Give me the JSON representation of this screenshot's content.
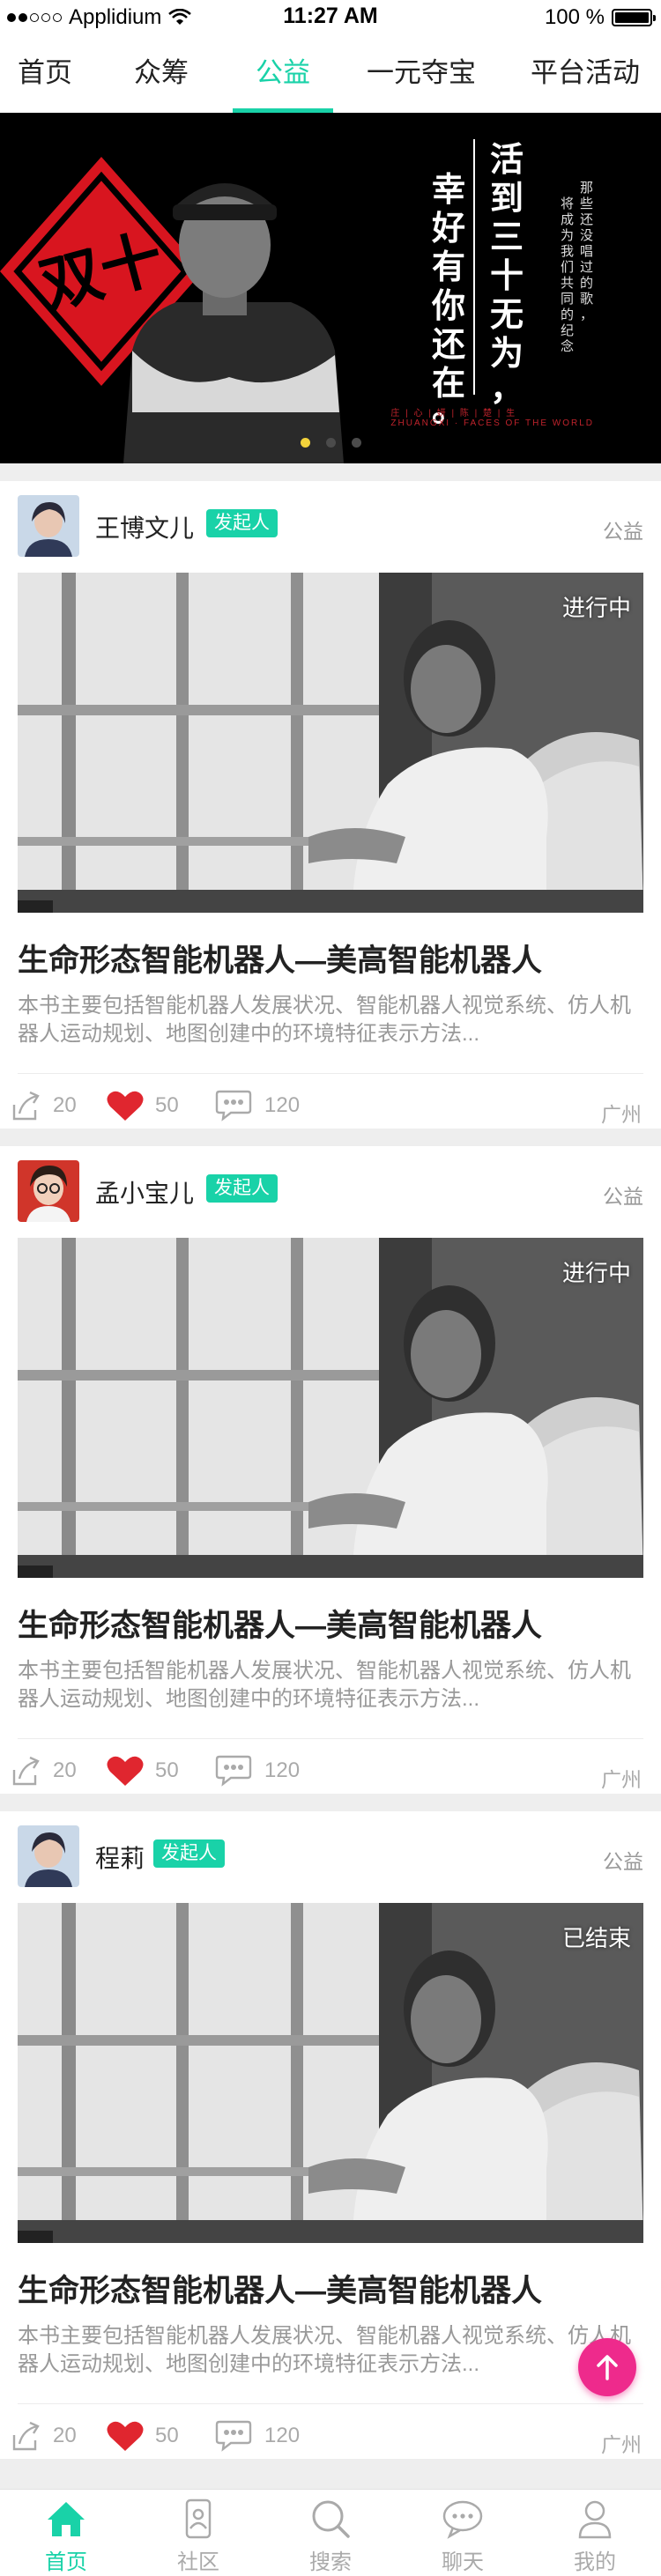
{
  "status_bar": {
    "carrier": "Applidium",
    "time": "11:27 AM",
    "battery": "100 %",
    "battery_level": 1.0
  },
  "top_tabs": [
    {
      "label": "首页",
      "active": false
    },
    {
      "label": "众筹",
      "active": false
    },
    {
      "label": "公益",
      "active": true
    },
    {
      "label": "一元夺宝",
      "active": false
    },
    {
      "label": "平台活动",
      "active": false
    }
  ],
  "banner": {
    "headline": [
      "活到三十无为，",
      "幸好有你还在。"
    ],
    "side_text": [
      "那些还没唱过的歌，",
      "将成为我们共同的纪念"
    ],
    "emblem": "双十",
    "credit_cn": "庄 | 心 | 妍 | 陈 | 楚 | 生",
    "credit_en": "ZHUANGXI · FACES OF THE WORLD",
    "slides": 3,
    "active_slide": 1
  },
  "accent_color": "#19d2a8",
  "cards": [
    {
      "user": "王博文儿",
      "badge": "发起人",
      "category": "公益",
      "status": "进行中",
      "title": "生命形态智能机器人—美高智能机器人",
      "description": "本书主要包括智能机器人发展状况、智能机器人视觉系统、仿人机器人运动规划、地图创建中的环境特征表示方法...",
      "shares": "20",
      "likes": "50",
      "comments": "120",
      "location": "广州"
    },
    {
      "user": "孟小宝儿",
      "badge": "发起人",
      "category": "公益",
      "status": "进行中",
      "title": "生命形态智能机器人—美高智能机器人",
      "description": "本书主要包括智能机器人发展状况、智能机器人视觉系统、仿人机器人运动规划、地图创建中的环境特征表示方法...",
      "shares": "20",
      "likes": "50",
      "comments": "120",
      "location": "广州"
    },
    {
      "user": "程莉",
      "badge": "发起人",
      "category": "公益",
      "status": "已结束",
      "title": "生命形态智能机器人—美高智能机器人",
      "description": "本书主要包括智能机器人发展状况、智能机器人视觉系统、仿人机器人运动规划、地图创建中的环境特征表示方法...",
      "shares": "20",
      "likes": "50",
      "comments": "120",
      "location": "广州"
    }
  ],
  "bottom_nav": [
    {
      "label": "首页",
      "icon": "home-icon",
      "active": true
    },
    {
      "label": "社区",
      "icon": "community-icon",
      "active": false
    },
    {
      "label": "搜索",
      "icon": "search-icon",
      "active": false
    },
    {
      "label": "聊天",
      "icon": "chat-icon",
      "active": false
    },
    {
      "label": "我的",
      "icon": "profile-icon",
      "active": false
    }
  ]
}
